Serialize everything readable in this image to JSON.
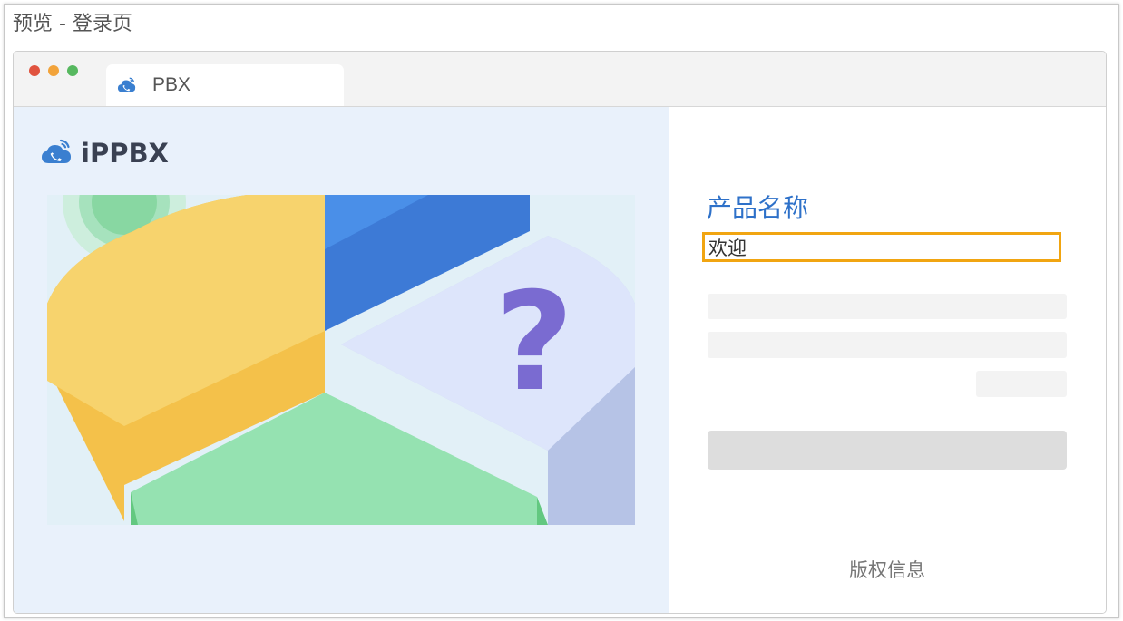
{
  "page": {
    "title": "预览 - 登录页"
  },
  "browser": {
    "window_controls": [
      "close",
      "minimize",
      "maximize"
    ],
    "tab": {
      "label": "PBX",
      "icon": "cloud-phone-icon"
    }
  },
  "left": {
    "logo": {
      "text": "iPPBX",
      "icon": "cloud-phone-icon"
    },
    "illustration": {
      "icon": "question-mark-icon",
      "glyph": "?"
    }
  },
  "login": {
    "product_name": "产品名称",
    "welcome": "欢迎",
    "username_placeholder": "",
    "password_placeholder": "",
    "copyright": "版权信息"
  },
  "colors": {
    "accent": "#2e71c9",
    "highlight": "#f1a511",
    "left_bg": "#e9f1fb"
  }
}
